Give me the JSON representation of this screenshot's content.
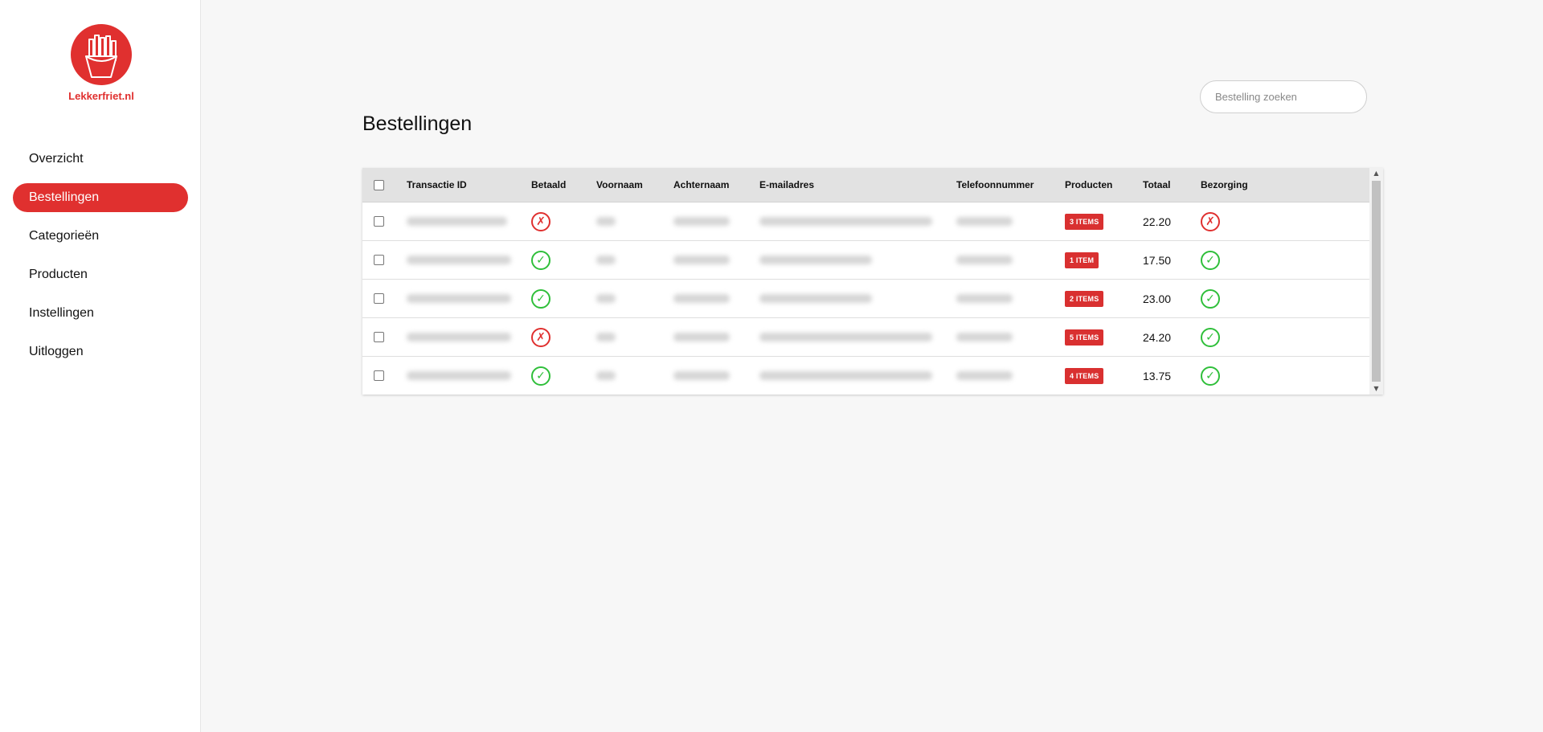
{
  "app": {
    "logo_text": "Lekkerfriet.nl",
    "brand_color": "#e0302f"
  },
  "nav": [
    {
      "label": "Overzicht",
      "active": false
    },
    {
      "label": "Bestellingen",
      "active": true
    },
    {
      "label": "Categorieën",
      "active": false
    },
    {
      "label": "Producten",
      "active": false
    },
    {
      "label": "Instellingen",
      "active": false
    },
    {
      "label": "Uitloggen",
      "active": false
    }
  ],
  "page": {
    "title": "Bestellingen"
  },
  "search": {
    "placeholder": "Bestelling zoeken",
    "value": ""
  },
  "table": {
    "columns": [
      "Transactie ID",
      "Betaald",
      "Voornaam",
      "Achternaam",
      "E-mailadres",
      "Telefoonnummer",
      "Producten",
      "Totaal",
      "Bezorging"
    ],
    "rows": [
      {
        "paid": false,
        "products": "3 ITEMS",
        "total": "22.20",
        "delivered": false
      },
      {
        "paid": true,
        "products": "1 ITEM",
        "total": "17.50",
        "delivered": true
      },
      {
        "paid": true,
        "products": "2 ITEMS",
        "total": "23.00",
        "delivered": true
      },
      {
        "paid": false,
        "products": "5 ITEMS",
        "total": "24.20",
        "delivered": true
      },
      {
        "paid": true,
        "products": "4 ITEMS",
        "total": "13.75",
        "delivered": true
      }
    ]
  },
  "icons": {
    "check": "check-circle-icon",
    "cross": "cross-circle-icon"
  },
  "colors": {
    "success": "#2fbf3a",
    "danger": "#e0302f",
    "badge": "#d93030"
  }
}
